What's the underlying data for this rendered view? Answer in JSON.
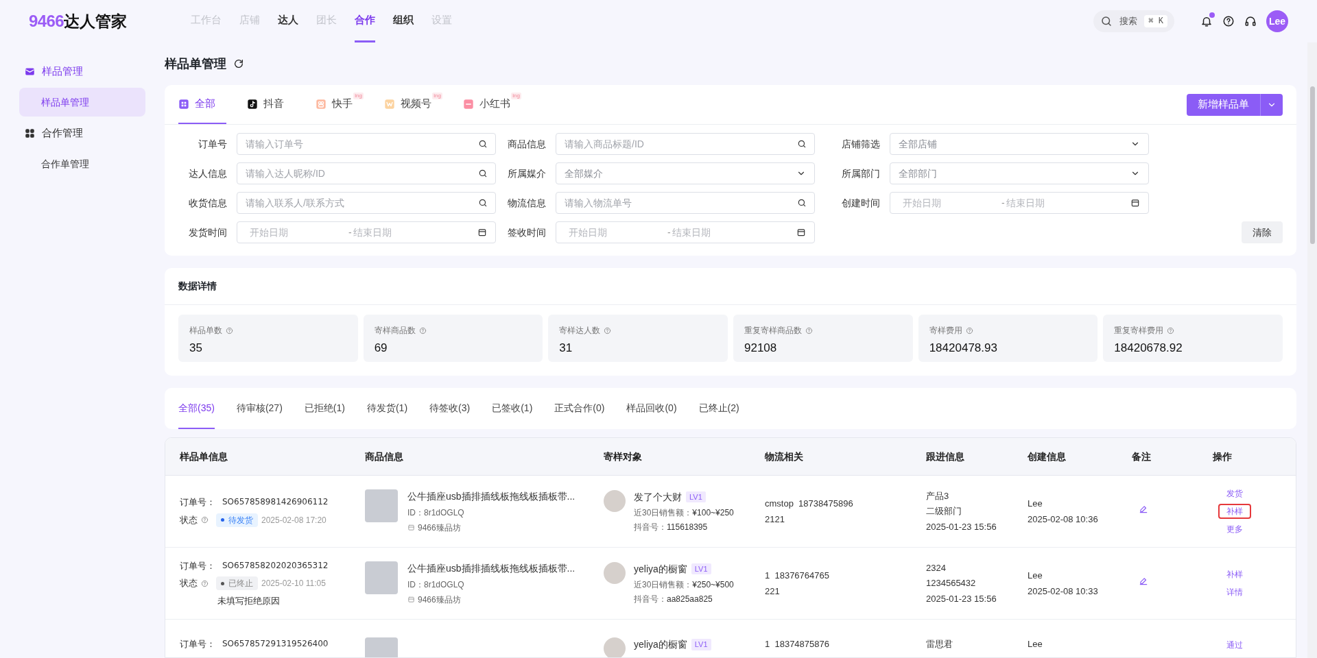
{
  "logo": {
    "number": "9466",
    "name": "达人管家"
  },
  "nav": [
    {
      "label": "工作台",
      "selected": false,
      "disabled": true
    },
    {
      "label": "店铺",
      "selected": false,
      "disabled": true
    },
    {
      "label": "达人",
      "selected": false,
      "disabled": false
    },
    {
      "label": "团长",
      "selected": false,
      "disabled": true
    },
    {
      "label": "合作",
      "selected": true,
      "disabled": false
    },
    {
      "label": "组织",
      "selected": false,
      "disabled": false
    },
    {
      "label": "设置",
      "selected": false,
      "disabled": true
    }
  ],
  "search": {
    "label": "搜索",
    "shortcut": "⌘ K"
  },
  "notifications": {
    "unread": true
  },
  "user": {
    "initials": "Lee"
  },
  "sidebar": [
    {
      "label": "样品管理",
      "kind": "mail",
      "children": [
        {
          "label": "样品单管理",
          "selected": true
        }
      ]
    },
    {
      "label": "合作管理",
      "kind": "grid",
      "children": [
        {
          "label": "合作单管理",
          "selected": false
        }
      ]
    }
  ],
  "page_title": "样品单管理",
  "platform_tabs": [
    {
      "label": "全部",
      "kind": "all",
      "selected": true
    },
    {
      "label": "抖音",
      "kind": "douyin",
      "selected": false
    },
    {
      "label": "快手",
      "kind": "kuaishou",
      "selected": false,
      "badge": "ing"
    },
    {
      "label": "视频号",
      "kind": "channels",
      "selected": false,
      "badge": "ing"
    },
    {
      "label": "小红书",
      "kind": "xhs",
      "selected": false,
      "badge": "ing"
    }
  ],
  "new_button": "新增样品单",
  "filters": [
    {
      "label": "订单号",
      "kind": "search",
      "placeholder": "请输入订单号"
    },
    {
      "label": "商品信息",
      "kind": "search",
      "placeholder": "请输入商品标题/ID"
    },
    {
      "label": "店铺筛选",
      "kind": "select",
      "placeholder": "全部店铺"
    },
    {
      "label": "达人信息",
      "kind": "search",
      "placeholder": "请输入达人昵称/ID"
    },
    {
      "label": "所属媒介",
      "kind": "select",
      "placeholder": "全部媒介"
    },
    {
      "label": "所属部门",
      "kind": "select",
      "placeholder": "全部部门"
    },
    {
      "label": "收货信息",
      "kind": "search",
      "placeholder": "请输入联系人/联系方式"
    },
    {
      "label": "物流信息",
      "kind": "search",
      "placeholder": "请输入物流单号"
    },
    {
      "label": "创建时间",
      "kind": "daterange",
      "start": {
        "placeholder": "开始日期"
      },
      "separator": "-",
      "end": {
        "placeholder": "结束日期"
      }
    },
    {
      "label": "发货时间",
      "kind": "daterange",
      "start": {
        "placeholder": "开始日期"
      },
      "separator": "-",
      "end": {
        "placeholder": "结束日期"
      }
    },
    {
      "label": "签收时间",
      "kind": "daterange",
      "start": {
        "placeholder": "开始日期"
      },
      "separator": "-",
      "end": {
        "placeholder": "结束日期"
      }
    }
  ],
  "clear_button": "清除",
  "stats_title": "数据详情",
  "stats": [
    {
      "label": "样品单数",
      "value": "35"
    },
    {
      "label": "寄样商品数",
      "value": "69"
    },
    {
      "label": "寄样达人数",
      "value": "31"
    },
    {
      "label": "重复寄样商品数",
      "value": "92108"
    },
    {
      "label": "寄样费用",
      "value": "18420478.93"
    },
    {
      "label": "重复寄样费用",
      "value": "18420678.92"
    }
  ],
  "status_tabs": [
    {
      "label": "全部(35)",
      "selected": true
    },
    {
      "label": "待审核(27)",
      "selected": false
    },
    {
      "label": "已拒绝(1)",
      "selected": false
    },
    {
      "label": "待发货(1)",
      "selected": false
    },
    {
      "label": "待签收(3)",
      "selected": false
    },
    {
      "label": "已签收(1)",
      "selected": false
    },
    {
      "label": "正式合作(0)",
      "selected": false
    },
    {
      "label": "样品回收(0)",
      "selected": false
    },
    {
      "label": "已终止(2)",
      "selected": false
    }
  ],
  "table": {
    "columns": [
      "样品单信息",
      "商品信息",
      "寄样对象",
      "物流相关",
      "跟进信息",
      "创建信息",
      "备注",
      "操作"
    ],
    "rows": [
      {
        "order_label": "订单号：",
        "order_no": "SO657858981426906112",
        "status_label": "状态",
        "status": {
          "label": "待发货",
          "kind": "pending"
        },
        "status_time": "2025-02-08 17:20",
        "product": {
          "title": "公牛插座usb插排插线板拖线板插板带...",
          "id": "ID：8r1dOGLQ",
          "shop": "9466臻品坊"
        },
        "target": {
          "name": "发了个大财",
          "level": "LV1",
          "sales_label": "近30日销售额：",
          "sales": "¥100~¥250",
          "account_label": "抖音号：",
          "account": "115618395"
        },
        "logistics": [
          "cmstop  18738475896",
          "2121"
        ],
        "follow": [
          "产品3",
          "二级部门",
          "2025-01-23 15:56"
        ],
        "created": [
          "Lee",
          "2025-02-08 10:36"
        ],
        "remark": true,
        "actions": [
          {
            "label": "发货",
            "highlighted": false
          },
          {
            "label": "补样",
            "highlighted": true
          },
          {
            "label": "更多",
            "highlighted": false
          }
        ]
      },
      {
        "order_label": "订单号：",
        "order_no": "SO657858202020365312",
        "status_label": "状态",
        "status": {
          "label": "已终止",
          "kind": "terminated"
        },
        "status_time": "2025-02-10 11:05",
        "note": "未填写拒绝原因",
        "product": {
          "title": "公牛插座usb插排插线板拖线板插板带...",
          "id": "ID：8r1dOGLQ",
          "shop": "9466臻品坊"
        },
        "target": {
          "name": "yeliya的橱窗",
          "level": "LV1",
          "sales_label": "近30日销售额：",
          "sales": "¥250~¥500",
          "account_label": "抖音号：",
          "account": "aa825aa825"
        },
        "logistics": [
          "1  18376764765",
          "221"
        ],
        "follow": [
          "2324",
          "1234565432",
          "2025-01-23 15:56"
        ],
        "created": [
          "Lee",
          "2025-02-08 10:33"
        ],
        "remark": true,
        "actions": [
          {
            "label": "补样",
            "highlighted": false
          },
          {
            "label": "详情",
            "highlighted": false
          }
        ]
      },
      {
        "order_label": "订单号：",
        "order_no": "SO657857291319526400",
        "product": {},
        "target": {
          "name": "yeliya的橱窗",
          "level": "LV1"
        },
        "logistics": [
          "1  18374875876"
        ],
        "follow": [
          "雷思君"
        ],
        "created": [
          "Lee"
        ],
        "actions": [
          {
            "label": "通过",
            "highlighted": false
          }
        ]
      }
    ]
  }
}
